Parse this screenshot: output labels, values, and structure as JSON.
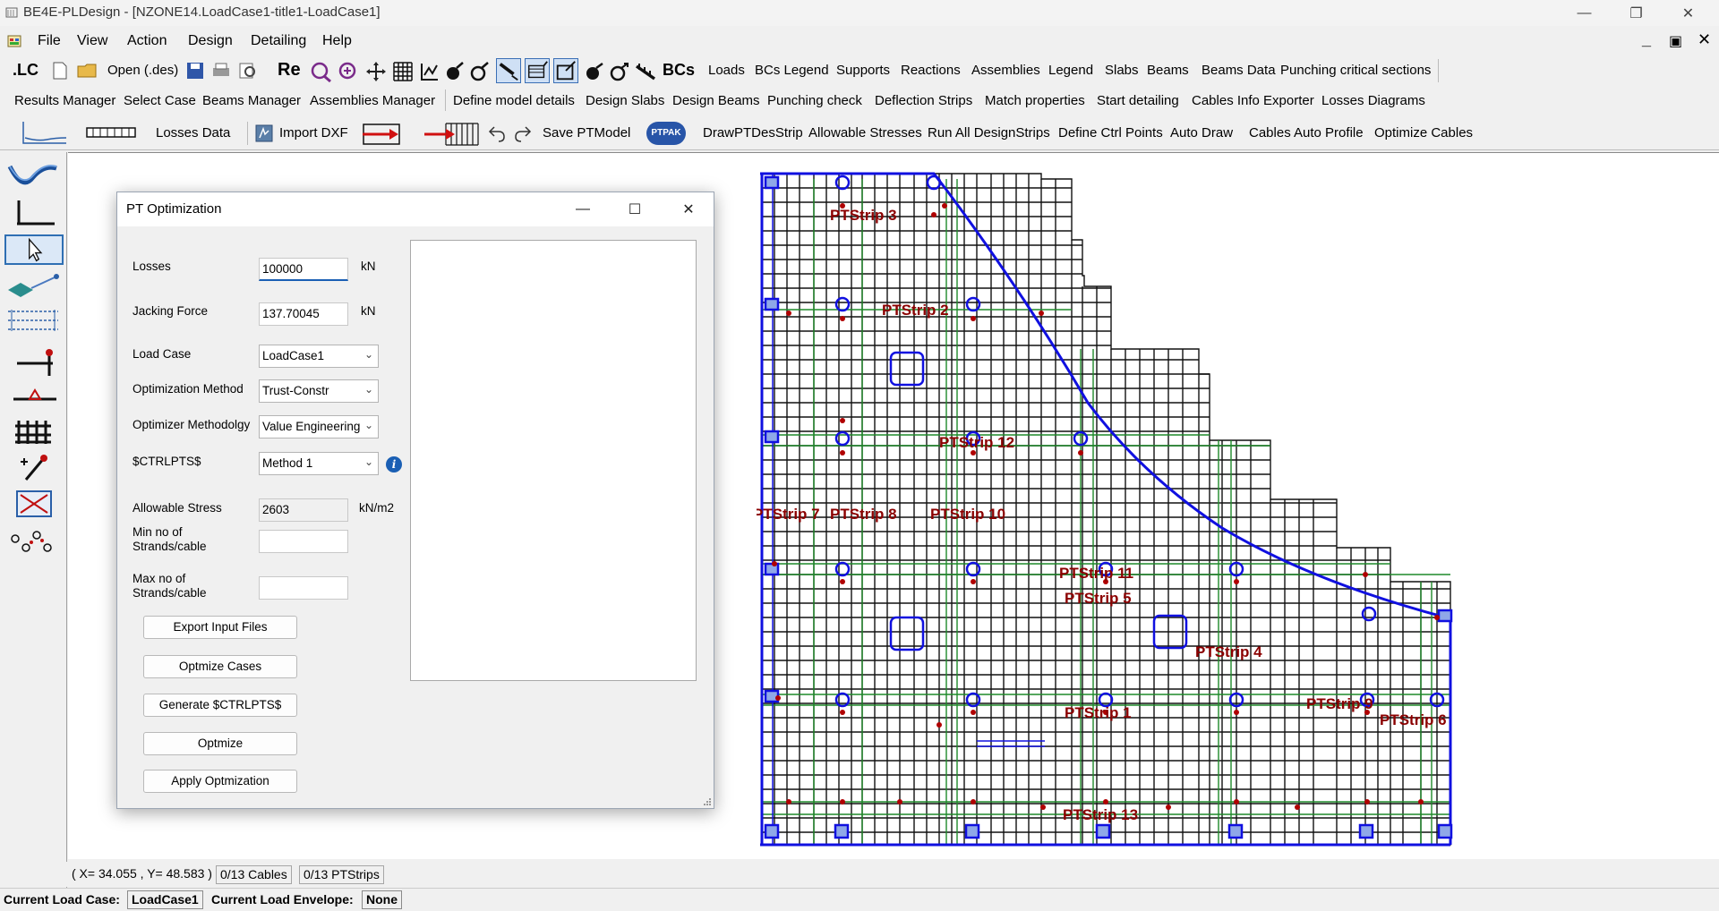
{
  "window": {
    "title": "BE4E-PLDesign - [NZONE14.LoadCase1-title1-LoadCase1]",
    "minimize": "—",
    "restore": "❐",
    "close": "✕"
  },
  "menu": {
    "items": [
      "File",
      "View",
      "Action",
      "Design",
      "Detailing",
      "Help"
    ],
    "mdi_min": "_",
    "mdi_restore": "▣",
    "mdi_close": "✕"
  },
  "toolbar1": {
    "lc": ".LC",
    "open": "Open (.des)",
    "re": "Re",
    "bcs": "BCs",
    "items": [
      "Loads",
      "BCs Legend",
      "Supports",
      "Reactions",
      "Assemblies",
      "Legend",
      "Slabs",
      "Beams",
      "Beams Data",
      "Punching critical sections"
    ]
  },
  "toolbar2": {
    "items": [
      "Results Manager",
      "Select Case",
      "Beams Manager",
      "Assemblies Manager",
      "Define model details",
      "Design Slabs",
      "Design Beams",
      "Punching check",
      "Deflection Strips",
      "Match properties",
      "Start detailing",
      "Cables Info Exporter",
      "Losses Diagrams"
    ]
  },
  "toolbar3": {
    "losses_data": "Losses Data",
    "import_dxf": "Import DXF",
    "save_ptmodel": "Save PTModel",
    "ptpak": "PTPAK",
    "items": [
      "DrawPTDesStrip",
      "Allowable Stresses",
      "Run All DesignStrips",
      "Define Ctrl Points",
      "Auto Draw",
      "Cables Auto Profile",
      "Optimize Cables"
    ]
  },
  "dialog": {
    "title": "PT Optimization",
    "minimize": "—",
    "maximize": "☐",
    "close": "✕",
    "losses_label": "Losses",
    "losses_value": "100000",
    "losses_unit": "kN",
    "jacking_label": "Jacking Force",
    "jacking_value": "137.70045",
    "jacking_unit": "kN",
    "loadcase_label": "Load Case",
    "loadcase_value": "LoadCase1",
    "method_label": "Optimization Method",
    "method_value": "Trust-Constr",
    "methodology_label": "Optimizer Methodolgy",
    "methodology_value": "Value Engineering",
    "ctrlpts_label": "$CTRLPTS$",
    "ctrlpts_value": "Method 1",
    "info": "i",
    "stress_label": "Allowable Stress",
    "stress_value": "2603",
    "stress_unit": "kN/m2",
    "min_label_1": "Min no of",
    "min_label_2": "Strands/cable",
    "max_label_1": "Max no of",
    "max_label_2": "Strands/cable",
    "buttons": [
      "Export Input Files",
      "Optmize Cases",
      "Generate $CTRLPTS$",
      "Optmize",
      "Apply Optmization"
    ]
  },
  "strips": [
    {
      "label": "PTStrip 3"
    },
    {
      "label": "PTStrip 2"
    },
    {
      "label": "PTStrip 12"
    },
    {
      "label": "PTStrip 7"
    },
    {
      "label": "PTStrip 8"
    },
    {
      "label": "PTStrip 10"
    },
    {
      "label": "PTStrip 11"
    },
    {
      "label": "PTStrip 5"
    },
    {
      "label": "PTStrip 4"
    },
    {
      "label": "PTStrip 1"
    },
    {
      "label": "PTStrip 9"
    },
    {
      "label": "PTStrip 6"
    },
    {
      "label": "PTStrip 13"
    }
  ],
  "status": {
    "coords": "( X= 34.055 , Y= 48.583 )",
    "cables": "0/13 Cables",
    "ptstrips": "0/13 PTStrips",
    "lc_label": "Current Load Case:",
    "lc_value": "LoadCase1",
    "env_label": "Current Load Envelope:",
    "env_value": "None"
  },
  "colors": {
    "strip_label": "#8b0000",
    "cable_blue": "#1010e0",
    "grid_green": "#228b22",
    "support_red": "#b00000"
  }
}
